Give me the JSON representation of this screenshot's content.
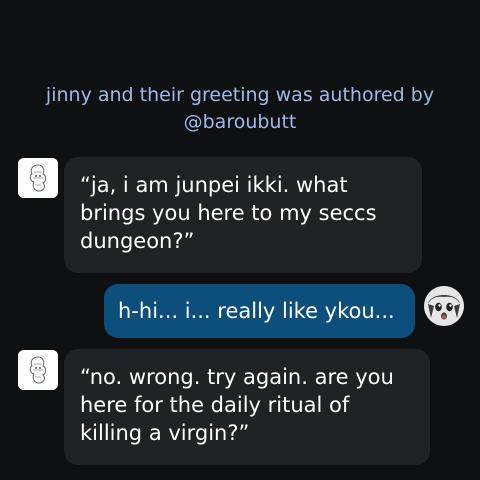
{
  "attribution": {
    "line1": "jinny and their greeting was authored by",
    "line2": "@baroubutt"
  },
  "messages": [
    {
      "sender": "bot",
      "avatar_icon": "bot-sketch-avatar-icon",
      "lines": [
        "“ja, i am junpei ikki. what",
        "brings you here to my seccs",
        "dungeon?”"
      ]
    },
    {
      "sender": "user",
      "avatar_icon": "user-anime-avatar-icon",
      "lines": [
        "h-hi... i... really like ykou..."
      ]
    },
    {
      "sender": "bot",
      "avatar_icon": "bot-sketch-avatar-icon",
      "lines": [
        "“no. wrong. try again. are you",
        "here for the daily ritual of",
        "killing a virgin?”"
      ]
    }
  ],
  "colors": {
    "background": "#0f1012",
    "attribution_text": "#9dbbe8",
    "bot_bubble": "#212226",
    "user_bubble": "#0c4f7d",
    "message_text": "#ffffff"
  }
}
